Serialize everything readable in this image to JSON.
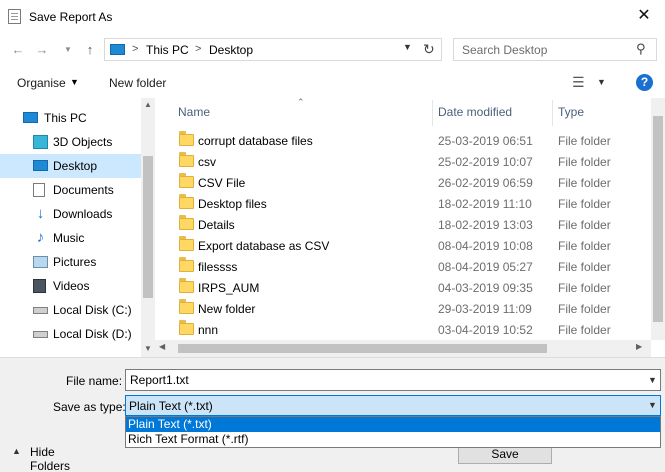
{
  "window": {
    "title": "Save Report As",
    "close_glyph": "✕"
  },
  "address": {
    "breadcrumbs": [
      "This PC",
      "Desktop"
    ],
    "separator": ">",
    "icon": "computer-icon"
  },
  "search": {
    "placeholder": "Search Desktop",
    "icon": "search-icon"
  },
  "toolbar": {
    "organise_label": "Organise",
    "new_folder_label": "New folder",
    "help_label": "?"
  },
  "sidebar": {
    "items": [
      {
        "label": "This PC",
        "icon": "computer-icon",
        "level": 0
      },
      {
        "label": "3D Objects",
        "icon": "cube-icon",
        "level": 1
      },
      {
        "label": "Desktop",
        "icon": "desktop-icon",
        "level": 1,
        "selected": true
      },
      {
        "label": "Documents",
        "icon": "document-icon",
        "level": 1
      },
      {
        "label": "Downloads",
        "icon": "download-icon",
        "level": 1
      },
      {
        "label": "Music",
        "icon": "music-icon",
        "level": 1
      },
      {
        "label": "Pictures",
        "icon": "picture-icon",
        "level": 1
      },
      {
        "label": "Videos",
        "icon": "video-icon",
        "level": 1
      },
      {
        "label": "Local Disk (C:)",
        "icon": "drive-icon",
        "level": 1
      },
      {
        "label": "Local Disk (D:)",
        "icon": "drive-icon",
        "level": 1
      }
    ]
  },
  "filelist": {
    "columns": [
      "Name",
      "Date modified",
      "Type"
    ],
    "rows": [
      {
        "name": "corrupt database files",
        "date": "25-03-2019 06:51",
        "type": "File folder"
      },
      {
        "name": "csv",
        "date": "25-02-2019 10:07",
        "type": "File folder"
      },
      {
        "name": "CSV File",
        "date": "26-02-2019 06:59",
        "type": "File folder"
      },
      {
        "name": "Desktop files",
        "date": "18-02-2019 11:10",
        "type": "File folder"
      },
      {
        "name": "Details",
        "date": "18-02-2019 13:03",
        "type": "File folder"
      },
      {
        "name": "Export database as CSV",
        "date": "08-04-2019 10:08",
        "type": "File folder"
      },
      {
        "name": "filessss",
        "date": "08-04-2019 05:27",
        "type": "File folder"
      },
      {
        "name": "IRPS_AUM",
        "date": "04-03-2019 09:35",
        "type": "File folder"
      },
      {
        "name": "New folder",
        "date": "29-03-2019 11:09",
        "type": "File folder"
      },
      {
        "name": "nnn",
        "date": "03-04-2019 10:52",
        "type": "File folder"
      }
    ]
  },
  "bottom": {
    "filename_label": "File name:",
    "filename_value": "Report1.txt",
    "saveas_label": "Save as type:",
    "saveas_value": "Plain Text (*.txt)",
    "saveas_options": [
      "Plain Text (*.txt)",
      "Rich Text Format (*.rtf)"
    ],
    "save_label": "Save",
    "hide_folders_label": "Hide Folders"
  },
  "colors": {
    "selection": "#cce8ff",
    "accent": "#0078d7",
    "folder": "#ffd763"
  }
}
